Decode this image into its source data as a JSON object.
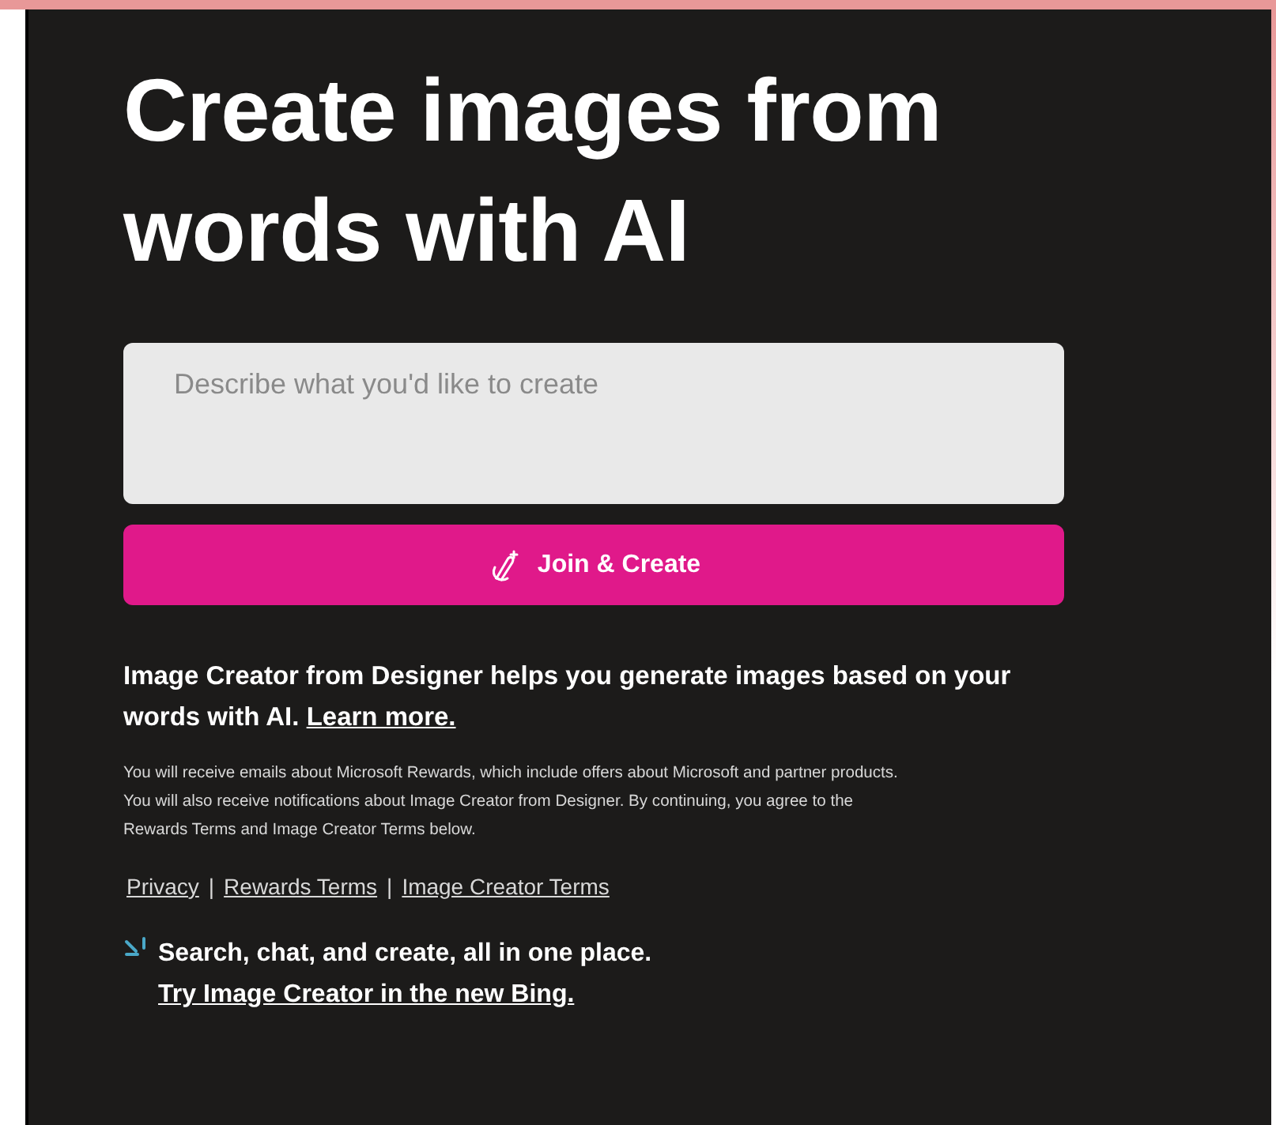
{
  "heading": "Create images from words with AI",
  "prompt": {
    "placeholder": "Describe what you'd like to create"
  },
  "create_button": {
    "label": "Join & Create"
  },
  "description": {
    "text": "Image Creator from Designer helps you generate images based on your words with AI.",
    "link": "Learn more."
  },
  "disclaimer": "You will receive emails about Microsoft Rewards, which include offers about Microsoft and partner products. You will also receive notifications about Image Creator from Designer. By continuing, you agree to the Rewards Terms and Image Creator Terms below.",
  "footer_links": [
    "Privacy",
    "Rewards Terms",
    "Image Creator Terms"
  ],
  "link_separator": "|",
  "promo": {
    "text": "Search, chat, and create, all in one place.",
    "link": "Try Image Creator in the new Bing."
  }
}
